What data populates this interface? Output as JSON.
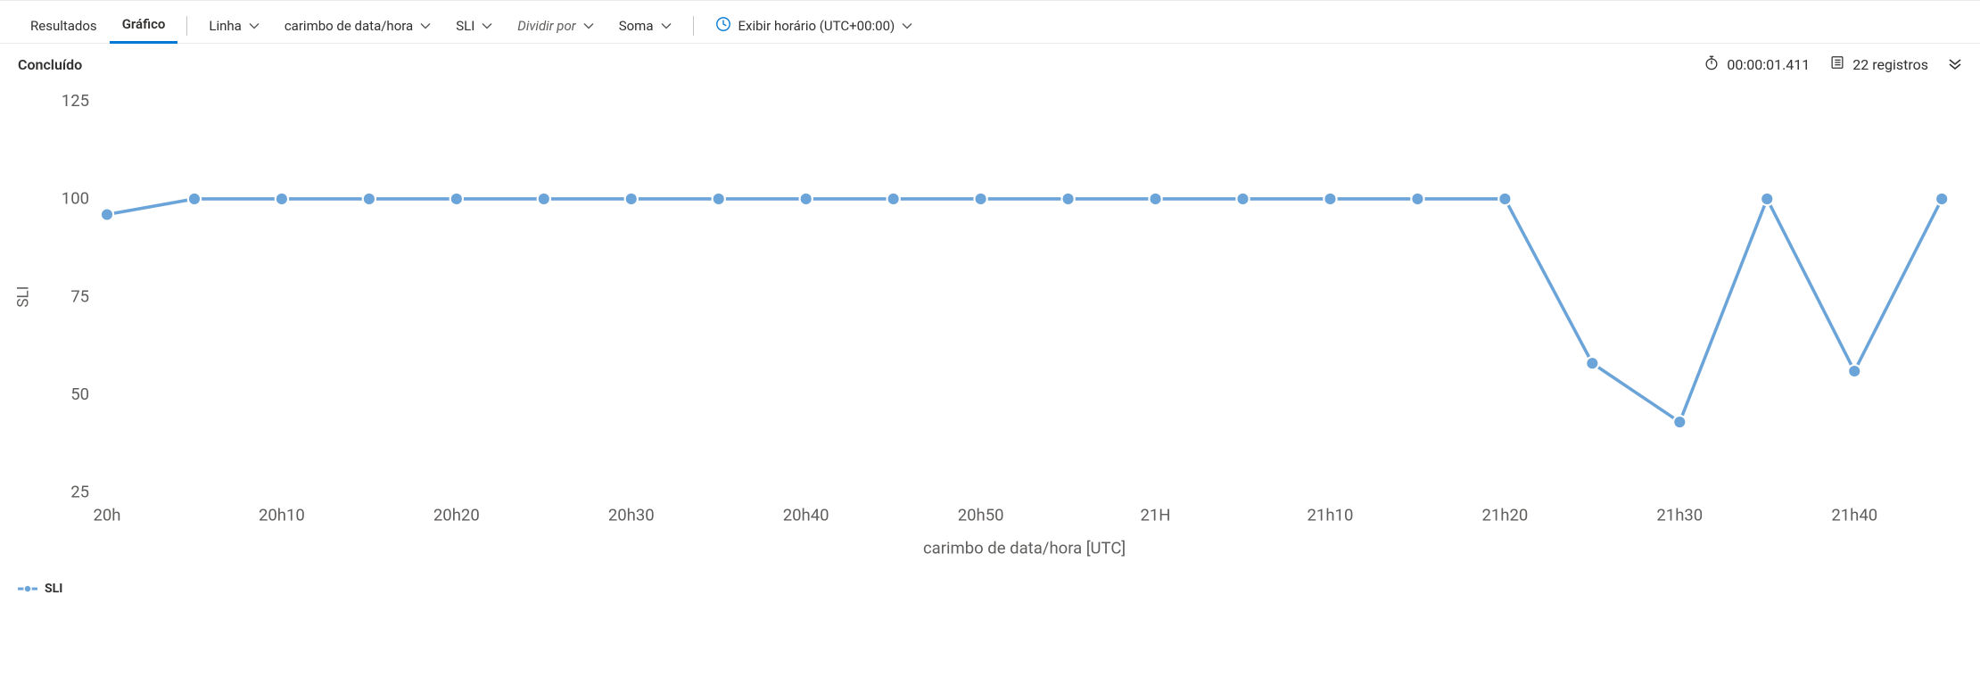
{
  "toolbar": {
    "tab_results": "Resultados",
    "tab_chart": "Gráfico",
    "chart_type": "Linha",
    "x_field": "carimbo de data/hora",
    "y_field": "SLI",
    "split_by": "Dividir por",
    "aggregate": "Soma",
    "tz_label": "Exibir horário (UTC+00:00)"
  },
  "status": {
    "title": "Concluído",
    "duration": "00:00:01.411",
    "records": "22 registros"
  },
  "legend": {
    "series0": "SLI"
  },
  "chart_data": {
    "type": "line",
    "title": "",
    "xlabel": "carimbo de data/hora [UTC]",
    "ylabel": "SLI",
    "ylim": [
      25,
      125
    ],
    "y_ticks": [
      25,
      50,
      75,
      100,
      125
    ],
    "x_tick_every": 2,
    "categories": [
      "20h",
      "20h05",
      "20h10",
      "20h15",
      "20h20",
      "20h25",
      "20h30",
      "20h35",
      "20h40",
      "20h45",
      "20h50",
      "20h55",
      "21H",
      "21h05",
      "21h10",
      "21h15",
      "21h20",
      "21h25",
      "21h30",
      "21h35",
      "21h40",
      "21h45"
    ],
    "series": [
      {
        "name": "SLI",
        "color": "#6ba4d8",
        "values": [
          96,
          100,
          100,
          100,
          100,
          100,
          100,
          100,
          100,
          100,
          100,
          100,
          100,
          100,
          100,
          100,
          100,
          58,
          43,
          100,
          56,
          100
        ]
      }
    ]
  }
}
